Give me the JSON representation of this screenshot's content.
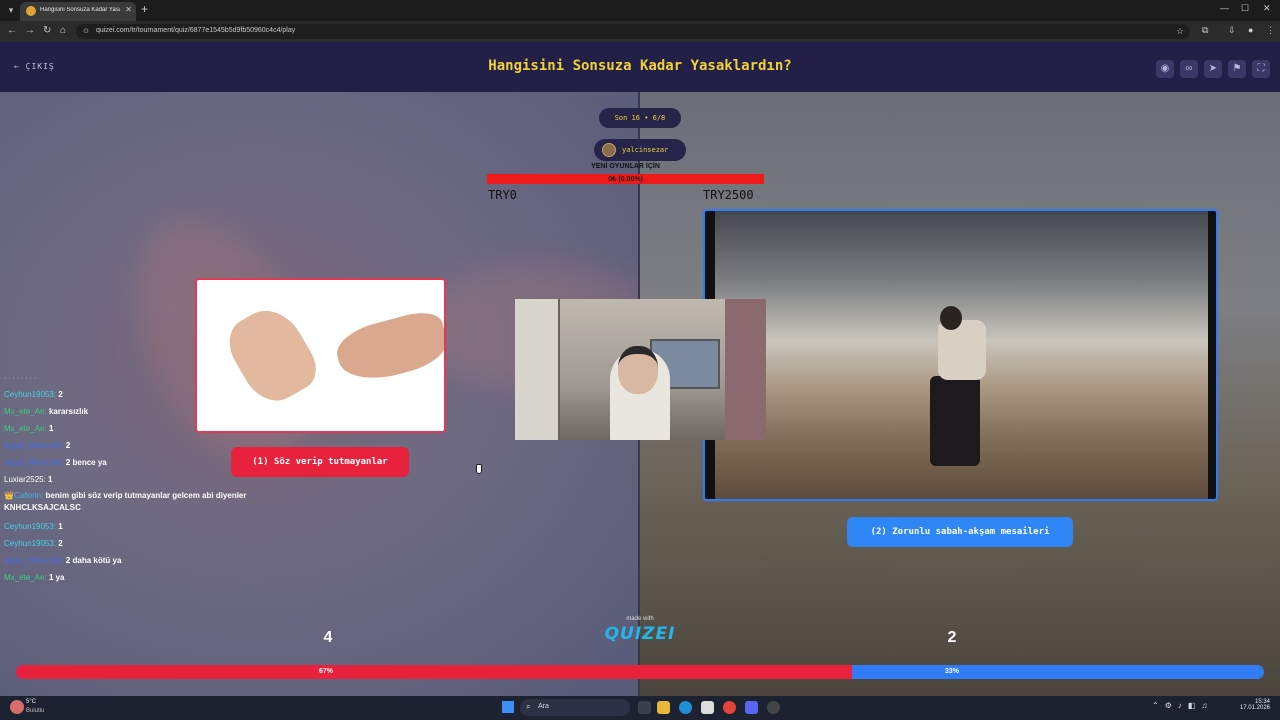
{
  "browser": {
    "tab_title": "Hangisini Sonsuza Kadar Yasakl...",
    "url": "quizei.com/tr/tournament/quiz/6877e1545b5d9fb50960c4c4/play",
    "controls": {
      "back": "←",
      "forward": "→",
      "reload": "↻",
      "home": "⌂",
      "minimize": "—",
      "maximize": "☐",
      "close": "✕",
      "new_tab": "+",
      "star": "☆"
    }
  },
  "header": {
    "exit_label": "ÇIKIŞ",
    "title": "Hangisini Sonsuza Kadar Yasaklardın?",
    "icons": [
      "eye-icon",
      "link-icon",
      "send-icon",
      "flag-icon",
      "fullscreen-icon"
    ]
  },
  "round": {
    "label": "Son 16 • 6/8",
    "username": "yalcinsezar"
  },
  "donation": {
    "label": "YENİ OYUNLAR İÇİN",
    "progress_text": "0₺ (0.00%)",
    "min": "TRY0",
    "max": "TRY2500",
    "progress": 0
  },
  "options": {
    "left": {
      "label": "(1) Söz verip tutmayanlar",
      "votes": "4",
      "percent": "67%",
      "color": "#e8213c"
    },
    "right": {
      "label": "(2) Zorunlu sabah-akşam mesaileri",
      "votes": "2",
      "percent": "33%",
      "color": "#2f7cf6"
    }
  },
  "vote_split": 0.67,
  "chat": {
    "top_dots": "· · · · · · · ·",
    "messages": [
      {
        "user": "Ceyhun19053:",
        "msg": "2",
        "color": "#3fd4e6"
      },
      {
        "user": "Mx_ete_Ae:",
        "msg": "kararsızlık",
        "color": "#39d07a"
      },
      {
        "user": "Mx_ete_Ae:",
        "msg": "1",
        "color": "#39d07a"
      },
      {
        "user": "argus_Minecraft:",
        "msg": "2",
        "color": "#3f6ee6"
      },
      {
        "user": "argus_Minecraft:",
        "msg": "2 bence ya",
        "color": "#3f6ee6"
      },
      {
        "user": "Luxiar2525:",
        "msg": "1",
        "color": "#ffffff"
      },
      {
        "user": "👑Callorin:",
        "msg": "benim gibi söz verip tutmayanlar gelcem abi diyenler KNHCLKSAJCALSC",
        "color": "#3fb6e6"
      },
      {
        "user": "Ceyhun19053:",
        "msg": "1",
        "color": "#3fd4e6"
      },
      {
        "user": "Ceyhun19053:",
        "msg": "2",
        "color": "#3fd4e6"
      },
      {
        "user": "argus_Minecraft:",
        "msg": "2 daha kötü ya",
        "color": "#3f6ee6"
      },
      {
        "user": "Mx_ete_Ae:",
        "msg": "1 ya",
        "color": "#39d07a"
      }
    ]
  },
  "branding": {
    "made_with": "made with",
    "name": "QUIZEI"
  },
  "taskbar": {
    "weather_temp": "5°C",
    "weather_desc": "Bulutlu",
    "search_placeholder": "Ara",
    "time": "15:34",
    "date": "17.01.2026"
  }
}
